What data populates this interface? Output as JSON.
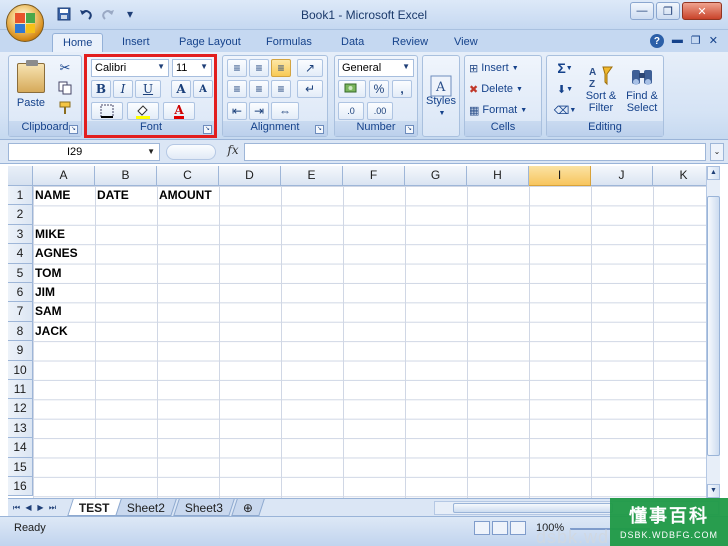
{
  "window": {
    "title": "Book1 - Microsoft Excel",
    "min_glyph": "—",
    "max_glyph": "❐",
    "close_glyph": "✕"
  },
  "qat": {
    "save_icon": "save-icon",
    "undo_icon": "undo-icon",
    "redo_icon": "redo-icon",
    "customize_glyph": "▾"
  },
  "tabs": [
    {
      "label": "Home",
      "active": true
    },
    {
      "label": "Insert"
    },
    {
      "label": "Page Layout"
    },
    {
      "label": "Formulas"
    },
    {
      "label": "Data"
    },
    {
      "label": "Review"
    },
    {
      "label": "View"
    }
  ],
  "ribbon_controls": {
    "help_glyph": "?",
    "minimize_glyph": "▬",
    "restore_glyph": "❐",
    "close_glyph": "✕"
  },
  "clipboard": {
    "label": "Clipboard",
    "paste": "Paste"
  },
  "font": {
    "label": "Font",
    "family": "Calibri",
    "size": "11",
    "bold": "B",
    "italic": "I",
    "underline": "U",
    "grow": "A",
    "shrink": "A",
    "font_color_glyph": "A"
  },
  "alignment": {
    "label": "Alignment"
  },
  "number": {
    "label": "Number",
    "format": "General",
    "percent": "%",
    "comma": ",",
    "inc_decimal": ".0",
    "dec_decimal": ".00"
  },
  "styles": {
    "label": "Styles"
  },
  "cells_group": {
    "label": "Cells",
    "insert": "Insert",
    "delete": "Delete",
    "format": "Format"
  },
  "editing": {
    "label": "Editing",
    "sum_glyph": "Σ",
    "sort_filter_1": "Sort &",
    "sort_filter_2": "Filter",
    "find_select_1": "Find &",
    "find_select_2": "Select"
  },
  "formula_bar": {
    "name_box": "I29",
    "fx": "fx",
    "formula": ""
  },
  "columns": [
    "A",
    "B",
    "C",
    "D",
    "E",
    "F",
    "G",
    "H",
    "I",
    "J",
    "K"
  ],
  "selected_column": "I",
  "rows": [
    "1",
    "2",
    "3",
    "4",
    "5",
    "6",
    "7",
    "8",
    "9",
    "10",
    "11",
    "12",
    "13",
    "14",
    "15",
    "16"
  ],
  "cells": [
    {
      "ref": "A1",
      "value": "NAME"
    },
    {
      "ref": "B1",
      "value": "DATE"
    },
    {
      "ref": "C1",
      "value": "AMOUNT"
    },
    {
      "ref": "A3",
      "value": "MIKE"
    },
    {
      "ref": "A4",
      "value": "AGNES"
    },
    {
      "ref": "A5",
      "value": "TOM"
    },
    {
      "ref": "A6",
      "value": "JIM"
    },
    {
      "ref": "A7",
      "value": "SAM"
    },
    {
      "ref": "A8",
      "value": "JACK"
    }
  ],
  "sheets": [
    {
      "label": "TEST",
      "active": true
    },
    {
      "label": "Sheet2"
    },
    {
      "label": "Sheet3"
    }
  ],
  "status": {
    "ready": "Ready",
    "zoom": "100%"
  },
  "watermark": {
    "line1": "懂事百科",
    "line2": "DSBK.WDBFG.COM",
    "url": "dsbk.wdbfg.com"
  },
  "colors": {
    "accent": "#15428b",
    "highlight_box": "#e21e1e",
    "selected_header": "#f7c55e",
    "watermark_bg": "#1f9a46"
  }
}
